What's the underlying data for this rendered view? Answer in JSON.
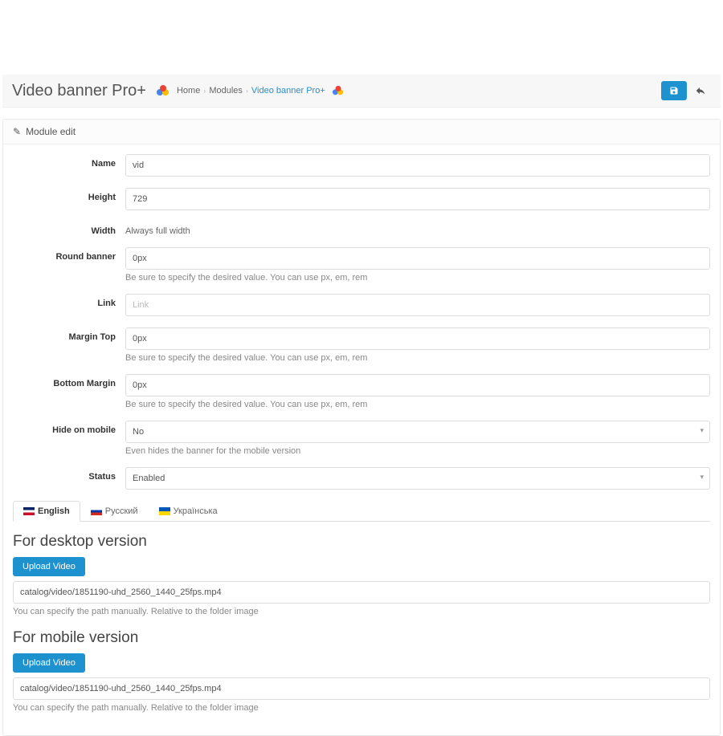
{
  "header": {
    "title": "Video banner Pro+",
    "breadcrumb": {
      "home": "Home",
      "modules": "Modules",
      "current": "Video banner Pro+"
    }
  },
  "panel": {
    "heading": "Module edit"
  },
  "form": {
    "name": {
      "label": "Name",
      "value": "vid"
    },
    "height": {
      "label": "Height",
      "value": "729"
    },
    "width": {
      "label": "Width",
      "static": "Always full width"
    },
    "round": {
      "label": "Round banner",
      "value": "0px",
      "help": "Be sure to specify the desired value. You can use px, em, rem"
    },
    "link": {
      "label": "Link",
      "placeholder": "Link",
      "value": ""
    },
    "marginTop": {
      "label": "Margin Top",
      "value": "0px",
      "help": "Be sure to specify the desired value. You can use px, em, rem"
    },
    "marginBottom": {
      "label": "Bottom Margin",
      "value": "0px",
      "help": "Be sure to specify the desired value. You can use px, em, rem"
    },
    "hideMobile": {
      "label": "Hide on mobile",
      "value": "No",
      "help": "Even hides the banner for the mobile version"
    },
    "status": {
      "label": "Status",
      "value": "Enabled"
    }
  },
  "tabs": {
    "english": "English",
    "russian": "Русский",
    "ukrainian": "Українська"
  },
  "desktop": {
    "title": "For desktop version",
    "upload": "Upload Video",
    "path": "catalog/video/1851190-uhd_2560_1440_25fps.mp4",
    "help": "You can specify the path manually. Relative to the folder image"
  },
  "mobile": {
    "title": "For mobile version",
    "upload": "Upload Video",
    "path": "catalog/video/1851190-uhd_2560_1440_25fps.mp4",
    "help": "You can specify the path manually. Relative to the folder image"
  }
}
